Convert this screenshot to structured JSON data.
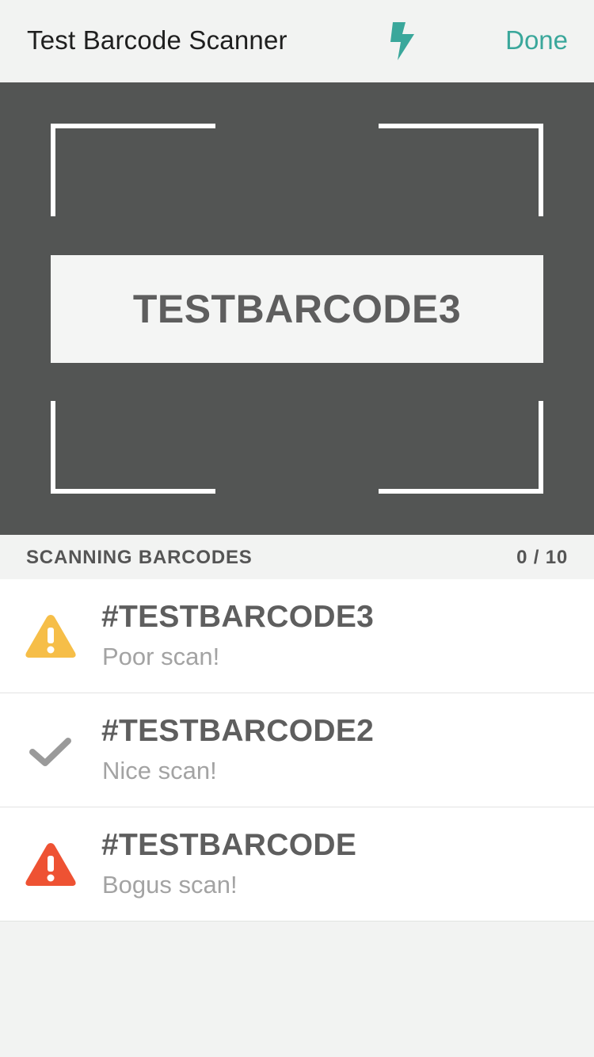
{
  "nav": {
    "title": "Test Barcode Scanner",
    "flash_icon": "lightning-bolt-icon",
    "done_label": "Done",
    "accent_color": "#3aa79b"
  },
  "scanner": {
    "detected_code": "TESTBARCODE3"
  },
  "section": {
    "title": "SCANNING BARCODES",
    "count": "0 / 10"
  },
  "scans": [
    {
      "code": "#TESTBARCODE3",
      "status": "Poor scan!",
      "icon": "warning-icon",
      "color": "#f6be48"
    },
    {
      "code": "#TESTBARCODE2",
      "status": "Nice scan!",
      "icon": "checkmark-icon",
      "color": "#9a9a9a"
    },
    {
      "code": "#TESTBARCODE",
      "status": "Bogus scan!",
      "icon": "error-icon",
      "color": "#ee5233"
    }
  ]
}
